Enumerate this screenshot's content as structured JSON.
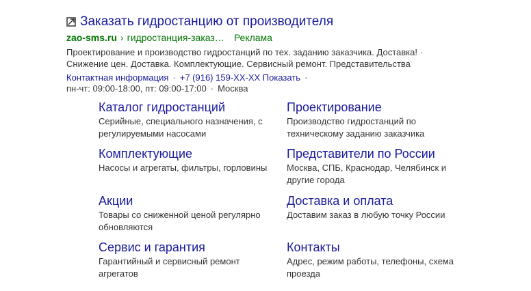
{
  "ad": {
    "favicon": "external-link-icon",
    "title": "Заказать гидростанцию от производителя",
    "domain": "zao-sms.ru",
    "separator": "›",
    "path": "гидростанция-заказ…",
    "badge": "Реклама",
    "description_line1": "Проектирование и производство гидростанций по тех. заданию заказчика. Доставка! ·",
    "description_line2": "Снижение цен. Доставка. Комплектующие. Сервисный ремонт. Представительства",
    "contacts": {
      "info_link": "Контактная информация",
      "bullet": "·",
      "phone": "+7 (916) 159-XX-XX",
      "show_link": "Показать",
      "hours": "пн-чт: 09:00-18:00, пт: 09:00-17:00",
      "city": "Москва"
    }
  },
  "sitelinks": [
    {
      "title": "Каталог гидростанций",
      "desc1": "Серийные, специального назначения, с",
      "desc2": "регулируемыми насосами"
    },
    {
      "title": "Проектирование",
      "desc1": "Производство гидростанций по",
      "desc2": "техническому заданию заказчика"
    },
    {
      "title": "Комплектующие",
      "desc1": "Насосы и агрегаты, фильтры, горловины",
      "desc2": ""
    },
    {
      "title": "Представители по России",
      "desc1": "Москва, СПБ, Краснодар, Челябинск и",
      "desc2": "другие города"
    },
    {
      "title": "Акции",
      "desc1": "Товары со сниженной ценой регулярно",
      "desc2": "обновляются"
    },
    {
      "title": "Доставка и оплата",
      "desc1": "Доставим заказ в любую точку России",
      "desc2": ""
    },
    {
      "title": "Сервис и гарантия",
      "desc1": "Гарантийный и сервисный ремонт",
      "desc2": "агрегатов"
    },
    {
      "title": "Контакты",
      "desc1": "Адрес, режим работы, телефоны, схема",
      "desc2": "проезда"
    }
  ],
  "colors": {
    "link": "#1a1a9c",
    "url_green": "#007700",
    "text": "#333333"
  }
}
